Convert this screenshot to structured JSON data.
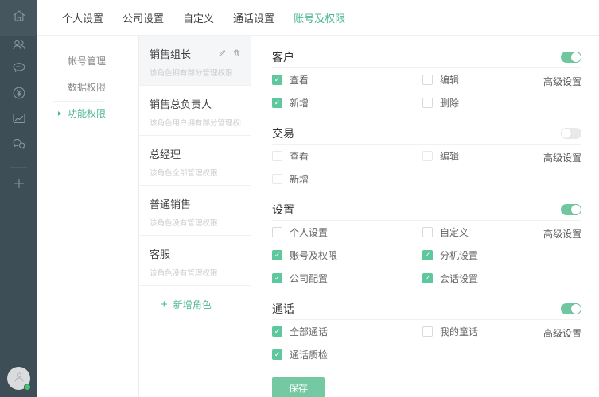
{
  "colors": {
    "accent": "#52b894",
    "toggle_on": "#6fc7a0",
    "checkbox_checked": "#5ec79d",
    "save_button": "#74c9a3",
    "rail_background": "#3e4e57"
  },
  "rail": {
    "icons": [
      "home-icon",
      "contacts-icon",
      "chat-icon",
      "billing-icon",
      "stats-icon",
      "wechat-icon",
      "add-icon"
    ],
    "avatar": {
      "status": "online"
    }
  },
  "top_nav": {
    "tabs": [
      {
        "label": "个人设置",
        "active": false
      },
      {
        "label": "公司设置",
        "active": false
      },
      {
        "label": "自定义",
        "active": false
      },
      {
        "label": "通话设置",
        "active": false
      },
      {
        "label": "账号及权限",
        "active": true
      }
    ]
  },
  "settings_nav": {
    "items": [
      {
        "label": "帐号管理",
        "active": false
      },
      {
        "label": "数据权限",
        "active": false
      },
      {
        "label": "功能权限",
        "active": true
      }
    ]
  },
  "roles": {
    "add_label": "新增角色",
    "items": [
      {
        "name": "销售组长",
        "desc": "该角色拥有部分管理权限",
        "selected": true,
        "actions": [
          "edit",
          "delete"
        ]
      },
      {
        "name": "销售总负责人",
        "desc": "该角色用户拥有部分管理权限",
        "selected": false,
        "actions": []
      },
      {
        "name": "总经理",
        "desc": "该角色全部管理权限",
        "selected": false,
        "actions": []
      },
      {
        "name": "普通销售",
        "desc": "该角色没有管理权限",
        "selected": false,
        "actions": []
      },
      {
        "name": "客服",
        "desc": "该角色没有管理权限",
        "selected": false,
        "actions": []
      }
    ]
  },
  "permissions": {
    "advanced_label": "高级设置",
    "save_label": "保存",
    "sections": [
      {
        "title": "客户",
        "enabled": true,
        "items": [
          {
            "label": "查看",
            "checked": true
          },
          {
            "label": "编辑",
            "checked": false
          },
          {
            "label": "新增",
            "checked": true
          },
          {
            "label": "删除",
            "checked": false
          }
        ]
      },
      {
        "title": "交易",
        "enabled": false,
        "items": [
          {
            "label": "查看",
            "checked": false
          },
          {
            "label": "编辑",
            "checked": false
          },
          {
            "label": "新增",
            "checked": false
          }
        ]
      },
      {
        "title": "设置",
        "enabled": true,
        "items": [
          {
            "label": "个人设置",
            "checked": false
          },
          {
            "label": "自定义",
            "checked": false
          },
          {
            "label": "账号及权限",
            "checked": true
          },
          {
            "label": "分机设置",
            "checked": true
          },
          {
            "label": "公司配置",
            "checked": true
          },
          {
            "label": "会话设置",
            "checked": true
          }
        ]
      },
      {
        "title": "通话",
        "enabled": true,
        "items": [
          {
            "label": "全部通话",
            "checked": true
          },
          {
            "label": "我的童话",
            "checked": false
          },
          {
            "label": "通话质检",
            "checked": true
          }
        ]
      }
    ]
  }
}
